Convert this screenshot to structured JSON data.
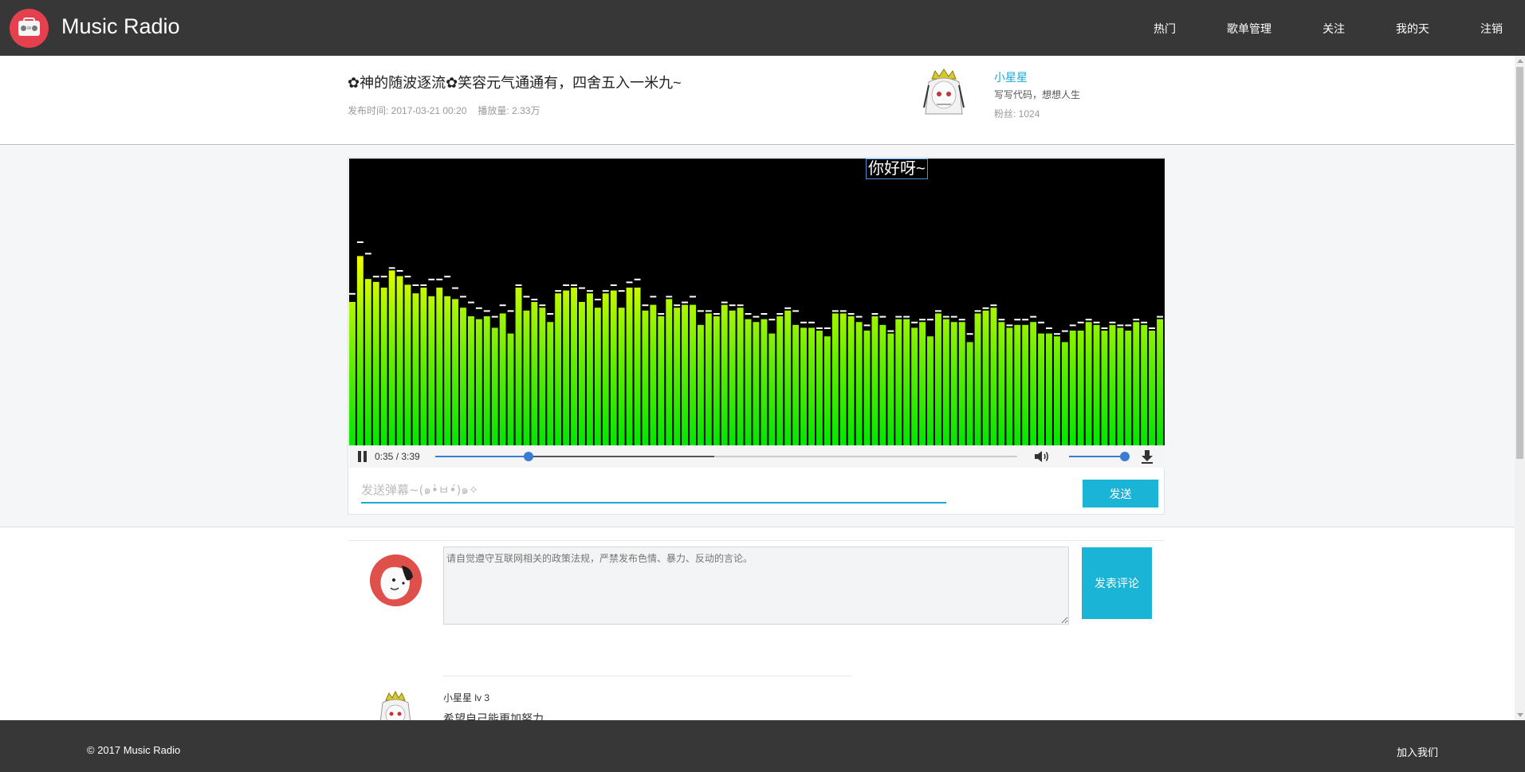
{
  "app": {
    "name": "Music Radio",
    "logo_icon": "radio-icon"
  },
  "nav": [
    {
      "label": "热门"
    },
    {
      "label": "歌单管理"
    },
    {
      "label": "关注"
    },
    {
      "label": "我的天"
    },
    {
      "label": "注销"
    }
  ],
  "song": {
    "title": "✿神的随波逐流✿笑容元气通通有，四舍五入一米九~",
    "publish_time": "发布时间: 2017-03-21 00:20",
    "play_count": "播放量: 2.33万"
  },
  "uploader": {
    "name": "小星星",
    "desc": "写写代码，想想人生",
    "fans": "粉丝: 1024"
  },
  "player": {
    "danmaku_text": "你好呀~",
    "time": "0:35 / 3:39",
    "progress": 0.16,
    "buffered": 0.48,
    "volume": 0.97,
    "danmaku_placeholder": "发送弹幕~(๑•̀ㅂ•́)๑✧",
    "send_label": "发送",
    "colors": {
      "bar_top": "#ffff00",
      "bar_bottom": "#00e600",
      "accent": "#1ab4d6"
    },
    "spectrum_levels": [
      0.5,
      0.66,
      0.58,
      0.57,
      0.55,
      0.61,
      0.59,
      0.56,
      0.53,
      0.55,
      0.52,
      0.55,
      0.52,
      0.51,
      0.48,
      0.45,
      0.44,
      0.45,
      0.41,
      0.46,
      0.39,
      0.55,
      0.47,
      0.5,
      0.48,
      0.43,
      0.53,
      0.54,
      0.55,
      0.5,
      0.53,
      0.48,
      0.53,
      0.54,
      0.48,
      0.55,
      0.55,
      0.47,
      0.49,
      0.45,
      0.51,
      0.48,
      0.49,
      0.49,
      0.42,
      0.46,
      0.45,
      0.49,
      0.47,
      0.48,
      0.44,
      0.43,
      0.44,
      0.39,
      0.45,
      0.47,
      0.42,
      0.41,
      0.41,
      0.4,
      0.38,
      0.46,
      0.46,
      0.45,
      0.43,
      0.4,
      0.45,
      0.42,
      0.39,
      0.44,
      0.44,
      0.41,
      0.43,
      0.38,
      0.46,
      0.44,
      0.43,
      0.43,
      0.36,
      0.46,
      0.47,
      0.48,
      0.43,
      0.41,
      0.42,
      0.42,
      0.43,
      0.39,
      0.39,
      0.38,
      0.36,
      0.4,
      0.4,
      0.43,
      0.42,
      0.4,
      0.42,
      0.41,
      0.4,
      0.43,
      0.42,
      0.4,
      0.44
    ],
    "spectrum_caps": [
      0.52,
      0.7,
      0.66,
      0.58,
      0.58,
      0.61,
      0.6,
      0.58,
      0.55,
      0.55,
      0.57,
      0.57,
      0.58,
      0.54,
      0.51,
      0.49,
      0.47,
      0.46,
      0.44,
      0.48,
      0.46,
      0.55,
      0.51,
      0.5,
      0.48,
      0.45,
      0.53,
      0.55,
      0.55,
      0.54,
      0.53,
      0.5,
      0.53,
      0.55,
      0.53,
      0.56,
      0.57,
      0.48,
      0.51,
      0.45,
      0.51,
      0.48,
      0.49,
      0.51,
      0.46,
      0.46,
      0.45,
      0.49,
      0.48,
      0.48,
      0.45,
      0.44,
      0.45,
      0.43,
      0.45,
      0.47,
      0.46,
      0.42,
      0.42,
      0.4,
      0.4,
      0.46,
      0.46,
      0.45,
      0.44,
      0.41,
      0.45,
      0.44,
      0.39,
      0.44,
      0.44,
      0.42,
      0.43,
      0.43,
      0.46,
      0.44,
      0.44,
      0.43,
      0.38,
      0.46,
      0.47,
      0.48,
      0.43,
      0.41,
      0.43,
      0.43,
      0.44,
      0.42,
      0.4,
      0.38,
      0.39,
      0.41,
      0.42,
      0.43,
      0.42,
      0.4,
      0.42,
      0.41,
      0.41,
      0.43,
      0.42,
      0.4,
      0.44
    ]
  },
  "comment": {
    "placeholder": "请自觉遵守互联网相关的政策法规，严禁发布色情、暴力、反动的言论。",
    "post_label": "发表评论",
    "items": [
      {
        "user": "小星星 lv 3",
        "text": "希望自己能更加努力"
      }
    ]
  },
  "footer": {
    "copyright": "© 2017 Music Radio",
    "join": "加入我们"
  }
}
